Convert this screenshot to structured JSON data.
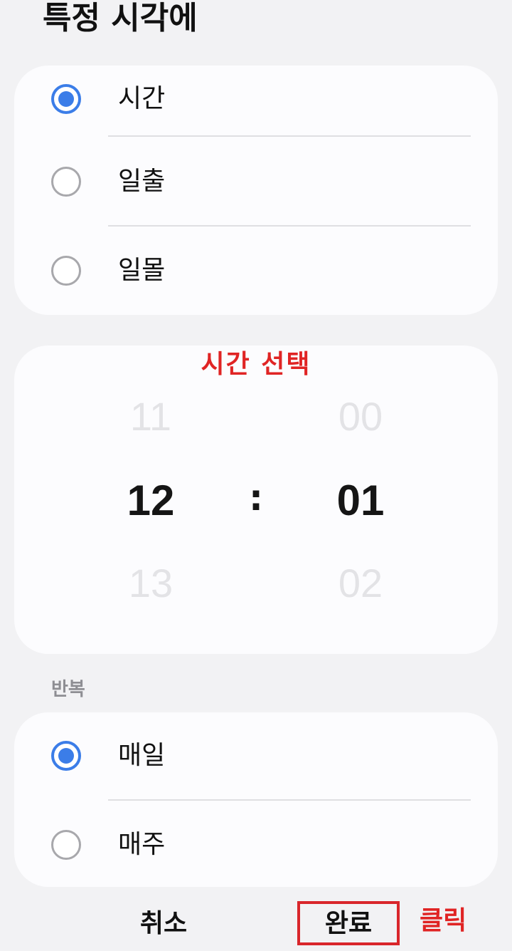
{
  "header": {
    "title": "특정 시각에"
  },
  "type_options": [
    {
      "label": "시간",
      "checked": true
    },
    {
      "label": "일출",
      "checked": false
    },
    {
      "label": "일몰",
      "checked": false
    }
  ],
  "picker": {
    "annotation": "시간 선택",
    "hour_prev": "11",
    "hour": "12",
    "hour_next": "13",
    "separator": ":",
    "minute_prev": "00",
    "minute": "01",
    "minute_next": "02"
  },
  "repeat": {
    "label": "반복",
    "options": [
      {
        "label": "매일",
        "checked": true
      },
      {
        "label": "매주",
        "checked": false
      }
    ]
  },
  "footer": {
    "cancel_label": "취소",
    "done_label": "완료",
    "click_annotation": "클릭"
  },
  "colors": {
    "accent": "#3b7de8",
    "annotation_red": "#e02424"
  }
}
